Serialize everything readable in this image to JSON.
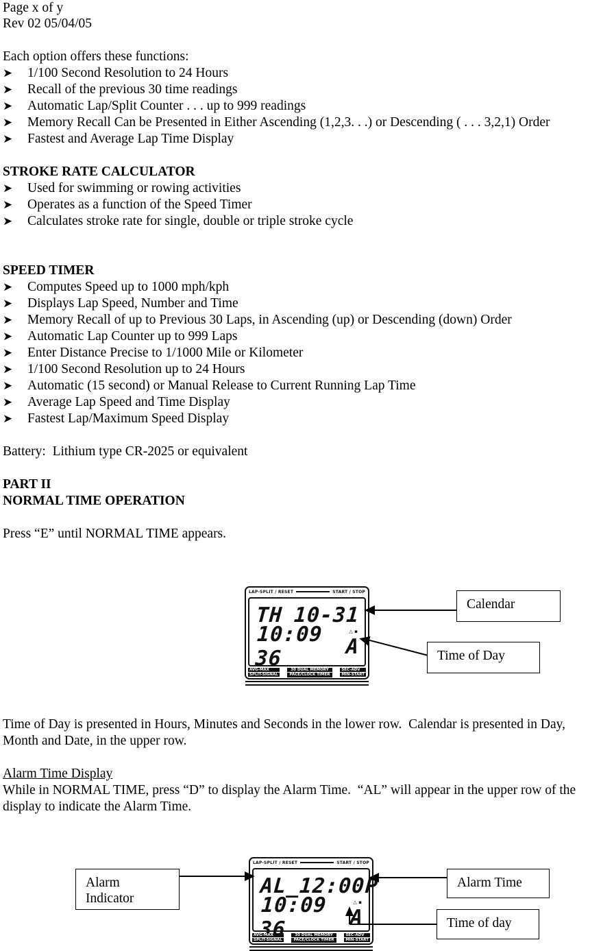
{
  "header": {
    "page_line": "Page x of y",
    "rev_line": "Rev 02 05/04/05"
  },
  "intro": {
    "lead": "Each option offers these functions:",
    "bullets": [
      "1/100 Second Resolution to 24 Hours",
      "Recall of the previous 30 time readings",
      "Automatic Lap/Split Counter . . . up to 999 readings",
      "Memory Recall Can be Presented in Either Ascending (1,2,3. . .) or Descending ( . . . 3,2,1) Order",
      "Fastest and Average Lap Time Display"
    ]
  },
  "stroke_rate": {
    "heading": "STROKE RATE CALCULATOR",
    "bullets": [
      "Used for swimming or rowing activities",
      "Operates as a function of the Speed Timer",
      "Calculates stroke rate for single, double or triple stroke cycle"
    ]
  },
  "speed_timer": {
    "heading": "SPEED TIMER",
    "bullets": [
      "Computes Speed up to 1000 mph/kph",
      "Displays Lap Speed, Number and Time",
      "Memory Recall of up to Previous 30 Laps, in Ascending (up) or Descending (down) Order",
      "Automatic Lap Counter up to 999 Laps",
      "Enter Distance Precise to 1/1000 Mile or Kilometer",
      "1/100 Second Resolution up to 24 Hours",
      "Automatic (15 second) or Manual Release to Current Running Lap Time",
      "Average Lap Speed and Time Display",
      "Fastest Lap/Maximum Speed Display"
    ]
  },
  "battery_line": "Battery:  Lithium type CR-2025 or equivalent",
  "part_two": {
    "part_label": "PART II",
    "section_title": "NORMAL TIME OPERATION",
    "instruction": "Press “E” until NORMAL TIME appears."
  },
  "figure_one": {
    "watch": {
      "top_left_label": "LAP-SPLIT / RESET",
      "top_right_label": "START / STOP",
      "lcd_top_left": "TH",
      "lcd_top_right": "10-31",
      "lcd_bottom_left": "10:09 36",
      "lcd_bottom_right": "A",
      "lcd_mini_indicator": "△ ▪",
      "btn_top_left": "AVG-MAX",
      "btn_bottom_left": "SPLIT-SIGNAL",
      "brand_line_1": "30 DUAL MEMORY",
      "brand_line_2": "PACE/CLOCK TIMER",
      "btn_top_right": "SEC-ADV",
      "btn_bottom_right": "MIN-START"
    },
    "callouts": {
      "calendar": "Calendar",
      "time_of_day": "Time of Day"
    }
  },
  "body_paragraph": "Time of Day is presented in Hours, Minutes and Seconds in the lower row.  Calendar is presented in Day,\nMonth and Date, in the upper row.",
  "alarm_section": {
    "heading": "Alarm Time Display",
    "paragraph_line_1": "While in NORMAL TIME, press “D” to display the Alarm Time.  “AL” will appear in the upper row of the",
    "paragraph_line_2": "display to indicate the Alarm Time."
  },
  "figure_two": {
    "watch": {
      "top_left_label": "LAP-SPLIT / RESET",
      "top_right_label": "START / STOP",
      "lcd_top_left": "AL_",
      "lcd_top_mid": "12:00",
      "lcd_top_right": "P",
      "lcd_bottom_left": "10:09 36",
      "lcd_bottom_right": "A",
      "lcd_mini_indicator": "△ ▪",
      "btn_top_left": "AVG-MAX",
      "btn_bottom_left": "SPLIT-SIGNAL",
      "brand_line_1": "30 DUAL MEMORY",
      "brand_line_2": "PACE/CLOCK TIMER",
      "btn_top_right": "SEC-ADV",
      "btn_bottom_right": "MIN-START"
    },
    "callouts": {
      "alarm_indicator": "Alarm\nIndicator",
      "alarm_time": "Alarm Time",
      "time_of_day": "Time of day"
    }
  },
  "colors": {
    "ink": "#000000",
    "paper": "#ffffff"
  }
}
